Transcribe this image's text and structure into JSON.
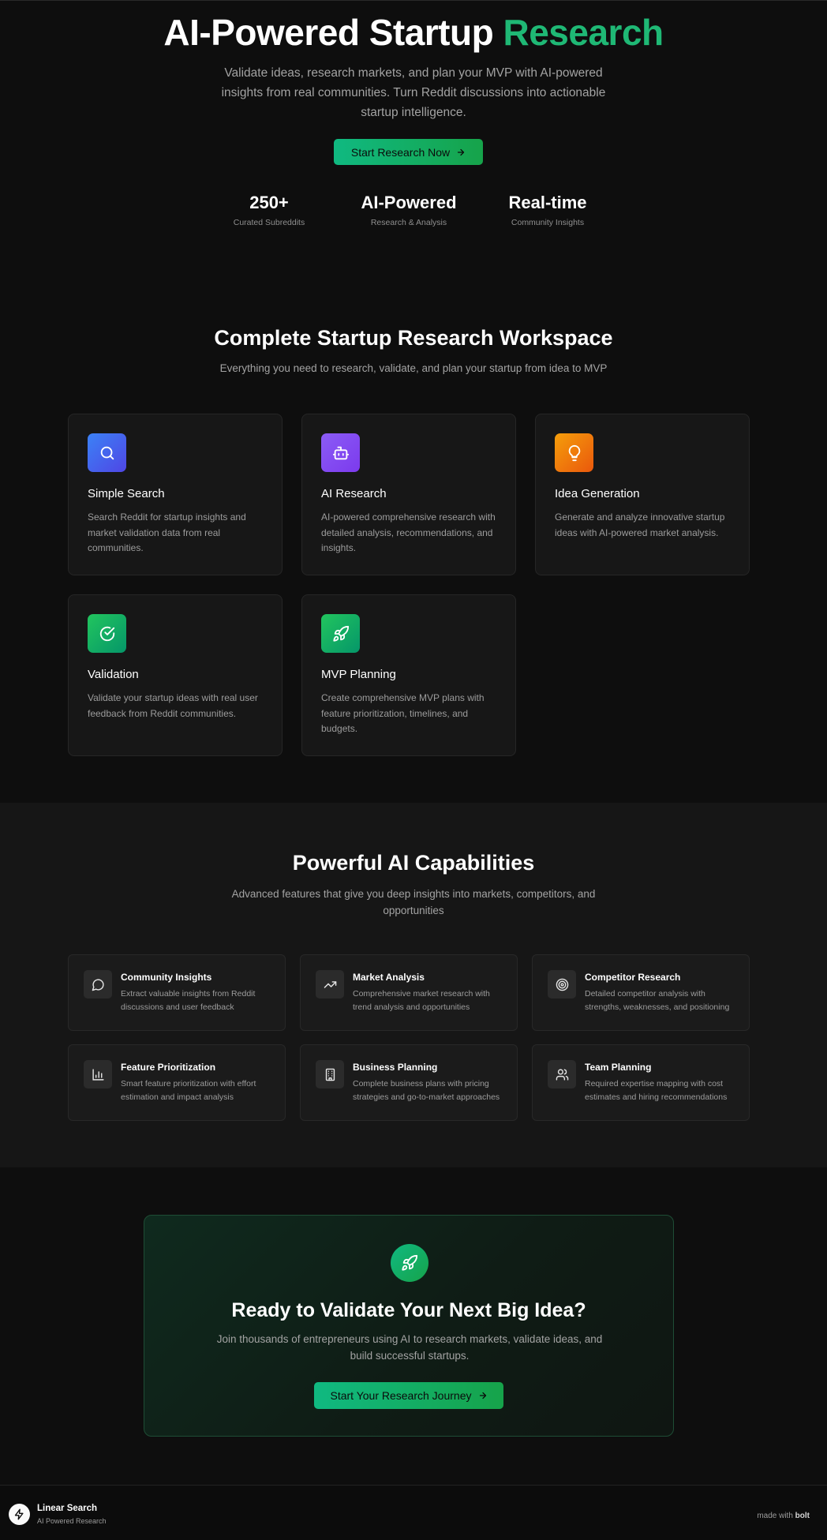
{
  "hero": {
    "title_main": "AI-Powered Startup ",
    "title_accent": "Research",
    "subtitle": "Validate ideas, research markets, and plan your MVP with AI-powered insights from real communities. Turn Reddit discussions into actionable startup intelligence.",
    "cta_label": "Start Research Now",
    "stats": [
      {
        "value": "250+",
        "label": "Curated Subreddits"
      },
      {
        "value": "AI-Powered",
        "label": "Research & Analysis"
      },
      {
        "value": "Real-time",
        "label": "Community Insights"
      }
    ]
  },
  "workspace": {
    "title": "Complete Startup Research Workspace",
    "subtitle": "Everything you need to research, validate, and plan your startup from idea to MVP",
    "cards": [
      {
        "title": "Simple Search",
        "description": "Search Reddit for startup insights and market validation data from real communities.",
        "icon": "search-icon",
        "color": "#4f46e5"
      },
      {
        "title": "AI Research",
        "description": "AI-powered comprehensive research with detailed analysis, recommendations, and insights.",
        "icon": "bot-icon",
        "color": "#7c3aed"
      },
      {
        "title": "Idea Generation",
        "description": "Generate and analyze innovative startup ideas with AI-powered market analysis.",
        "icon": "lightbulb-icon",
        "color": "#ea7a0c"
      },
      {
        "title": "Validation",
        "description": "Validate your startup ideas with real user feedback from Reddit communities.",
        "icon": "check-circle-icon",
        "color": "#16a34a"
      },
      {
        "title": "MVP Planning",
        "description": "Create comprehensive MVP plans with feature prioritization, timelines, and budgets.",
        "icon": "rocket-icon",
        "color": "#16a34a"
      }
    ]
  },
  "capabilities": {
    "title": "Powerful AI Capabilities",
    "subtitle": "Advanced features that give you deep insights into markets, competitors, and opportunities",
    "items": [
      {
        "title": "Community Insights",
        "description": "Extract valuable insights from Reddit discussions and user feedback",
        "icon": "message-circle-icon"
      },
      {
        "title": "Market Analysis",
        "description": "Comprehensive market research with trend analysis and opportunities",
        "icon": "trending-up-icon"
      },
      {
        "title": "Competitor Research",
        "description": "Detailed competitor analysis with strengths, weaknesses, and positioning",
        "icon": "target-icon"
      },
      {
        "title": "Feature Prioritization",
        "description": "Smart feature prioritization with effort estimation and impact analysis",
        "icon": "bar-chart-icon"
      },
      {
        "title": "Business Planning",
        "description": "Complete business plans with pricing strategies and go-to-market approaches",
        "icon": "building-icon"
      },
      {
        "title": "Team Planning",
        "description": "Required expertise mapping with cost estimates and hiring recommendations",
        "icon": "users-icon"
      }
    ]
  },
  "cta": {
    "title": "Ready to Validate Your Next Big Idea?",
    "subtitle": "Join thousands of entrepreneurs using AI to research markets, validate ideas, and build successful startups.",
    "button_label": "Start Your Research Journey",
    "icon": "rocket-icon"
  },
  "footer": {
    "brand": "Linear Search",
    "tagline": "AI Powered Research",
    "made_with_prefix": "made with ",
    "made_with_brand": "bolt",
    "logo_icon": "zap-icon"
  },
  "colors": {
    "accent": "#1fb875",
    "button": "#10b981",
    "background": "#0e0e0e",
    "card": "#171717"
  }
}
